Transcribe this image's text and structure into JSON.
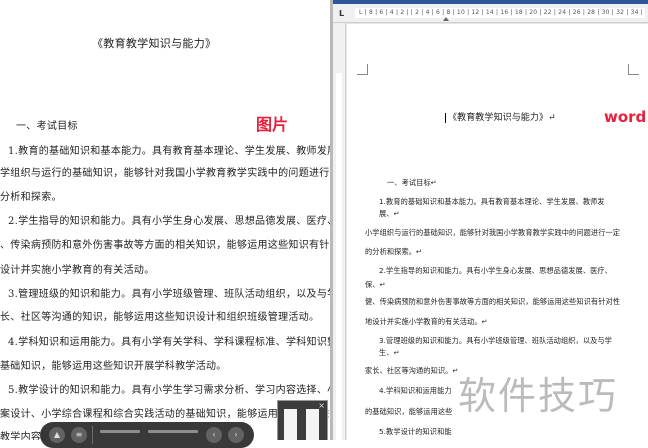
{
  "image_view": {
    "title": "《教育教学知识与能力》",
    "tag": "图片",
    "lines": [
      "一、考试目标",
      "1.教育的基础知识和基本能力。具有教育基本理论、学生发展、教师发展、",
      "学组织与运行的基础知识，能够针对我国小学教育教学实践中的问题进行一定",
      "分析和探索。",
      "2.学生指导的知识和能力。具有小学生身心发展、思想品德发展、医疗、保",
      "、传染病预防和意外伤害事故等方面的相关知识，能够运用这些知识有针对性",
      "设计并实施小学教育的有关活动。",
      "3.管理班级的知识和能力。具有小学班级管理、班队活动组织，以及与学生、",
      "长、社区等沟通的知识，能够运用这些知识设计和组织班级管理活动。",
      "4.学科知识和运用能力。具有小学有关学科、学科课程标准、学科知识整合",
      "基础知识，能够运用这些知识开展学科教学活动。",
      "5.教学设计的知识和能力。具有小学生学习需求分析、学习内容选择、小学",
      "案设计、小学综合课程和综合实践活动的基础知识，能够运用这些知识进行",
      "教学内容的"
    ]
  },
  "word_view": {
    "ruler": "L  | 8 | 6 | 4 | 2 |    | 2 | 4 | 6 | 8 | 10 | 12 | 14 | 16 | 18 | 20 | 22 | 24 | 26 | 28 | 30 | 32 | 34 |",
    "tab_selector": "L",
    "title": "《教育教学知识与能力》↵",
    "tag": "word",
    "lines": [
      "一、考试目标↵",
      "1.教育的基础知识和基本能力。具有教育基本理论、学生发展、教师发",
      "展、↵",
      "小学组织与运行的基础知识，能够针对我国小学教育教学实践中的问题进行一定",
      "的分析和探索。↵",
      "2.学生指导的知识和能力。具有小学生身心发展、思想品德发展、医疗、",
      "保、↵",
      "健、传染病预防和意外伤害事故等方面的相关知识，能够运用这些知识有针对性",
      "地设计并实施小学教育的有关活动。↵",
      "3.管理班级的知识和能力。具有小学班级管理、班队活动组织，以及与学",
      "生、↵",
      "家长、社区等沟通的知识。↵",
      "4.学科知识和运用能力",
      "的基础知识，能够运用这些",
      "5.教学设计的知识和能"
    ]
  },
  "watermark": "软件技巧",
  "toolbar": {
    "up_icon": "▲",
    "menu_icon": "≡",
    "prev_icon": "‹",
    "next_icon": "›"
  },
  "thumbnail": {
    "close": "×"
  },
  "colors": {
    "accent_red": "#e8203c",
    "word_blue": "#2b579a",
    "toolbar_bg": "#2f2f2f"
  }
}
